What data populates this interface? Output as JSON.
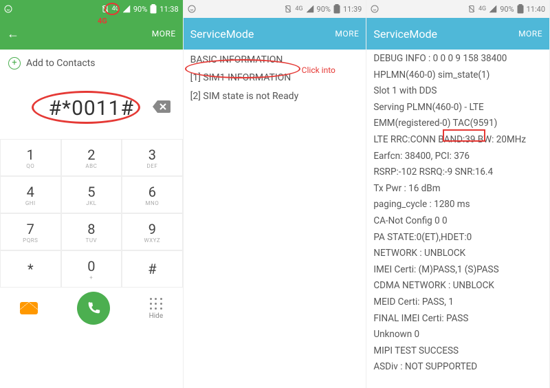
{
  "panel1": {
    "status": {
      "battery": "90%",
      "time": "11:38"
    },
    "header": {
      "more": "MORE"
    },
    "add_contacts": "Add to Contacts",
    "dialed": "#*0011#",
    "keys": [
      {
        "m": "1",
        "s": "QO"
      },
      {
        "m": "2",
        "s": "ABC"
      },
      {
        "m": "3",
        "s": "DEF"
      },
      {
        "m": "4",
        "s": "GHI"
      },
      {
        "m": "5",
        "s": "JKL"
      },
      {
        "m": "6",
        "s": "MNO"
      },
      {
        "m": "7",
        "s": "PQRS"
      },
      {
        "m": "8",
        "s": "TUV"
      },
      {
        "m": "9",
        "s": "WXYZ"
      },
      {
        "m": "*",
        "s": ""
      },
      {
        "m": "0",
        "s": "+"
      },
      {
        "m": "#",
        "s": ""
      }
    ],
    "hide_label": "Hide",
    "annot_4g": "4G"
  },
  "panel2": {
    "status": {
      "battery": "90%",
      "time": "11:39"
    },
    "title": "ServiceMode",
    "more": "MORE",
    "items": [
      "BASIC INFORMATION",
      "[1] SIM1 INFORMATION",
      "[2] SIM state is not Ready"
    ],
    "annot_click": "Click into"
  },
  "panel3": {
    "status": {
      "battery": "90%",
      "time": "11:40"
    },
    "title": "ServiceMode",
    "more": "MORE",
    "items": [
      "DEBUG INFO : 0 0 0 9 158 38400",
      "HPLMN(460-0) sim_state(1)",
      "Slot 1 with DDS",
      "Serving PLMN(460-0) - LTE",
      "EMM(registered-0) TAC(9591)",
      "LTE RRC:CONN BAND:39 BW: 20MHz",
      "Earfcn: 38400, PCI: 376",
      "RSRP:-102 RSRQ:-9 SNR:16.4",
      "Tx Pwr : 16 dBm",
      "paging_cycle : 1280 ms",
      "CA-Not Config 0 0",
      "PA STATE:0(ET),HDET:0",
      "NETWORK : UNBLOCK",
      "IMEI Certi: (M)PASS,1 (S)PASS",
      "CDMA NETWORK : UNBLOCK",
      "MEID Certi: PASS, 1",
      "FINAL IMEI Certi: PASS",
      "Unknown 0",
      "MIPI TEST SUCCESS",
      "ASDiv : NOT SUPPORTED"
    ]
  }
}
